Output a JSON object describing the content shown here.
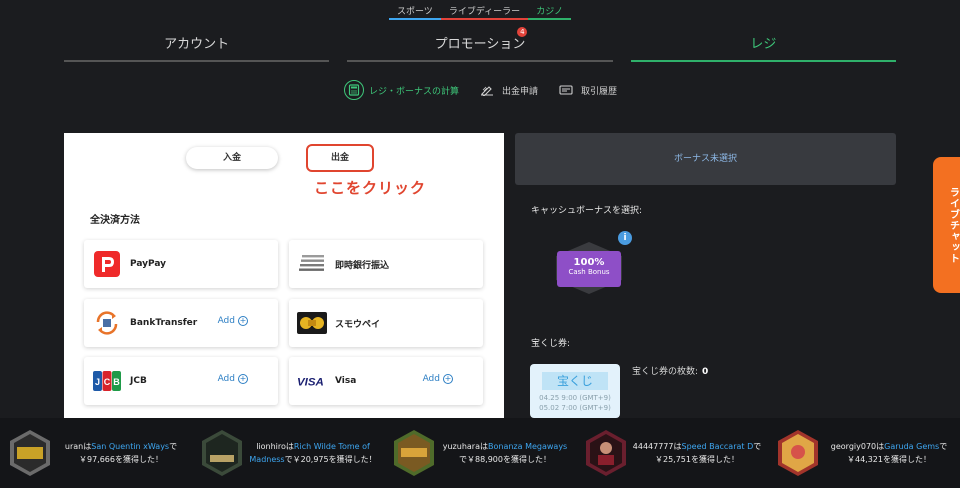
{
  "topnav": [
    {
      "label": "スポーツ",
      "color": "#3ea6f0"
    },
    {
      "label": "ライブディーラー",
      "color": "#e2433a"
    },
    {
      "label": "カジノ",
      "color": "#2fb06a"
    }
  ],
  "tabs": [
    {
      "label": "アカウント"
    },
    {
      "label": "プロモーション",
      "badge": "4"
    },
    {
      "label": "レジ",
      "active": true
    }
  ],
  "subnav": [
    {
      "label": "レジ・ボーナスの計算",
      "icon": "calculator-icon"
    },
    {
      "label": "出金申請",
      "icon": "pen-icon"
    },
    {
      "label": "取引履歴",
      "icon": "receipt-icon"
    }
  ],
  "deposit_tabs": {
    "deposit": "入金",
    "withdraw": "出金"
  },
  "annotation": "ここをクリック",
  "methods_title": "全決済方法",
  "methods": [
    {
      "name": "PayPay",
      "logo": "paypay-logo"
    },
    {
      "name": "即時銀行振込",
      "logo": "bank-stripes-logo"
    },
    {
      "name": "BankTransfer",
      "logo": "bank-transfer-logo",
      "add": "Add"
    },
    {
      "name": "スモウペイ",
      "logo": "sumopay-logo"
    },
    {
      "name": "JCB",
      "logo": "jcb-logo",
      "add": "Add"
    },
    {
      "name": "Visa",
      "logo": "visa-logo",
      "add": "Add"
    }
  ],
  "bonus": {
    "unselected": "ボーナス未選択",
    "cash_label": "キャッシュボーナスを選択:",
    "card_pct": "100%",
    "card_text": "Cash Bonus",
    "info": "i"
  },
  "lottery": {
    "label": "宝くじ券:",
    "ticket_title": "宝くじ",
    "date1": "04.25 9:00 (GMT+9)",
    "date2": "05.02 7:00 (GMT+9)",
    "count_label": "宝くじ券の枚数:",
    "count": "0"
  },
  "livechat": "ライブチャット",
  "ticker": [
    {
      "user": "uran",
      "ha": "は",
      "game": "San Quentin xWays",
      "de": "で",
      "amount": "￥97,666",
      "suffix": "を獲得した！"
    },
    {
      "user": "lionhiro",
      "ha": "は",
      "game": "Rich Wilde Tome of Madness",
      "de": "で",
      "amount": "￥20,975",
      "suffix": "を獲得した！"
    },
    {
      "user": "yuzuhara",
      "ha": "は",
      "game": "Bonanza Megaways",
      "de": "で",
      "amount": "￥88,900",
      "suffix": "を獲得した！"
    },
    {
      "user": "44447777",
      "ha": "は",
      "game": "Speed Baccarat D",
      "de": "で",
      "amount": "￥25,751",
      "suffix": "を獲得した！"
    },
    {
      "user": "georgiy070",
      "ha": "は",
      "game": "Garuda Gems",
      "de": "で",
      "amount": "￥44,321",
      "suffix": "を獲得した！"
    }
  ]
}
